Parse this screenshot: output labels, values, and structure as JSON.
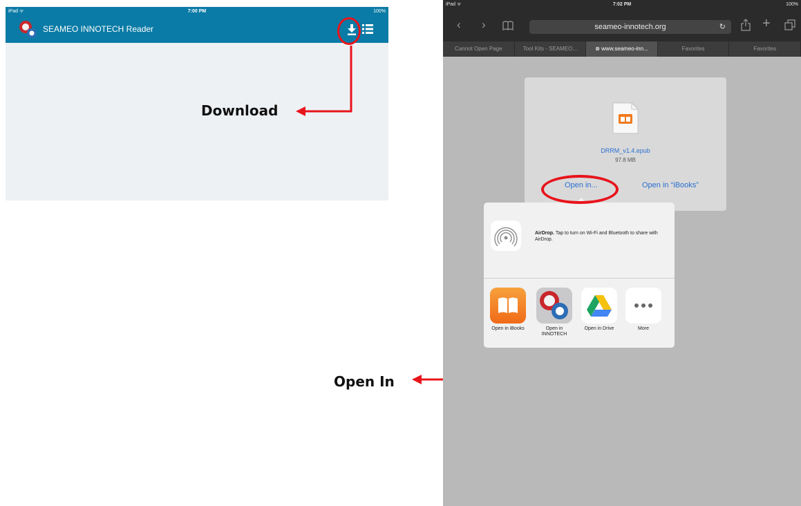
{
  "left_screen": {
    "status": {
      "device": "iPad ᯤ",
      "time": "7:00 PM",
      "battery": "100%"
    },
    "app_title": "SEAMEO INNOTECH Reader"
  },
  "annotations": {
    "download_label": "Download",
    "open_in_label": "Open In",
    "highlight_color": "#e8141b"
  },
  "right_screen": {
    "status": {
      "device": "iPad ᯤ",
      "time": "7:02 PM",
      "battery": "100%"
    },
    "url": "seameo-innotech.org",
    "tabs": [
      {
        "label": "Cannot Open Page",
        "active": false
      },
      {
        "label": "Tool Kits - SEAMEO...",
        "active": false
      },
      {
        "label": "⊗ www.seameo-inn...",
        "active": true
      },
      {
        "label": "Favorites",
        "active": false
      },
      {
        "label": "Favorites",
        "active": false
      }
    ],
    "file": {
      "name": "DRRM_v1.4.epub",
      "size": "97.8 MB"
    },
    "open_in_link": "Open in...",
    "open_in_ibooks_link": "Open in “iBooks”",
    "airdrop": {
      "title": "AirDrop.",
      "text": "Tap to turn on Wi-Fi and Bluetooth to share with AirDrop."
    },
    "apps": [
      {
        "label": "Open in iBooks"
      },
      {
        "label": "Open in INNOTECH"
      },
      {
        "label": "Open in Drive"
      },
      {
        "label": "More"
      }
    ]
  }
}
